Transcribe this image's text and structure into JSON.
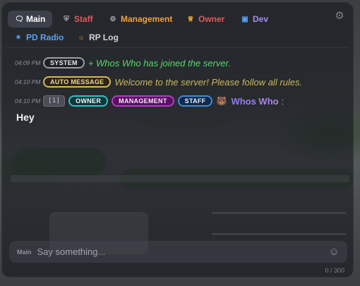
{
  "tabs": [
    {
      "label": "Main",
      "icon": "chat-bubble-icon",
      "color": "#ffffff",
      "active": true
    },
    {
      "label": "Staff",
      "icon": "shield-icon",
      "color": "#e05a5a"
    },
    {
      "label": "Management",
      "icon": "gear-icon",
      "color": "#f0a040"
    },
    {
      "label": "Owner",
      "icon": "crown-icon",
      "color": "#e05a5a"
    },
    {
      "label": "Dev",
      "icon": "monitor-icon",
      "color": "#a88cf0"
    },
    {
      "label": "PD Radio",
      "icon": "police-icon",
      "color": "#5aa0f0"
    },
    {
      "label": "RP Log",
      "icon": "mask-icon",
      "color": "#d0d2d6"
    }
  ],
  "messages": {
    "system": {
      "time": "04:09 PM",
      "badge": "SYSTEM",
      "text": "+ Whos Who has joined the server."
    },
    "auto": {
      "time": "04:10 PM",
      "badge": "AUTO MESSAGE",
      "text": "Welcome to the server! Please follow all rules."
    },
    "chat": {
      "time": "04:10 PM",
      "id_badge": "[1]",
      "roles": [
        "OWNER",
        "MANAGEMENT",
        "STAFF"
      ],
      "icon": "raccoon-icon",
      "author": "Whos Who",
      "separator": ":",
      "body": "Hey"
    }
  },
  "input": {
    "channel_tag": "Main",
    "placeholder": "Say something...",
    "value": "",
    "counter": "0 / 300"
  }
}
